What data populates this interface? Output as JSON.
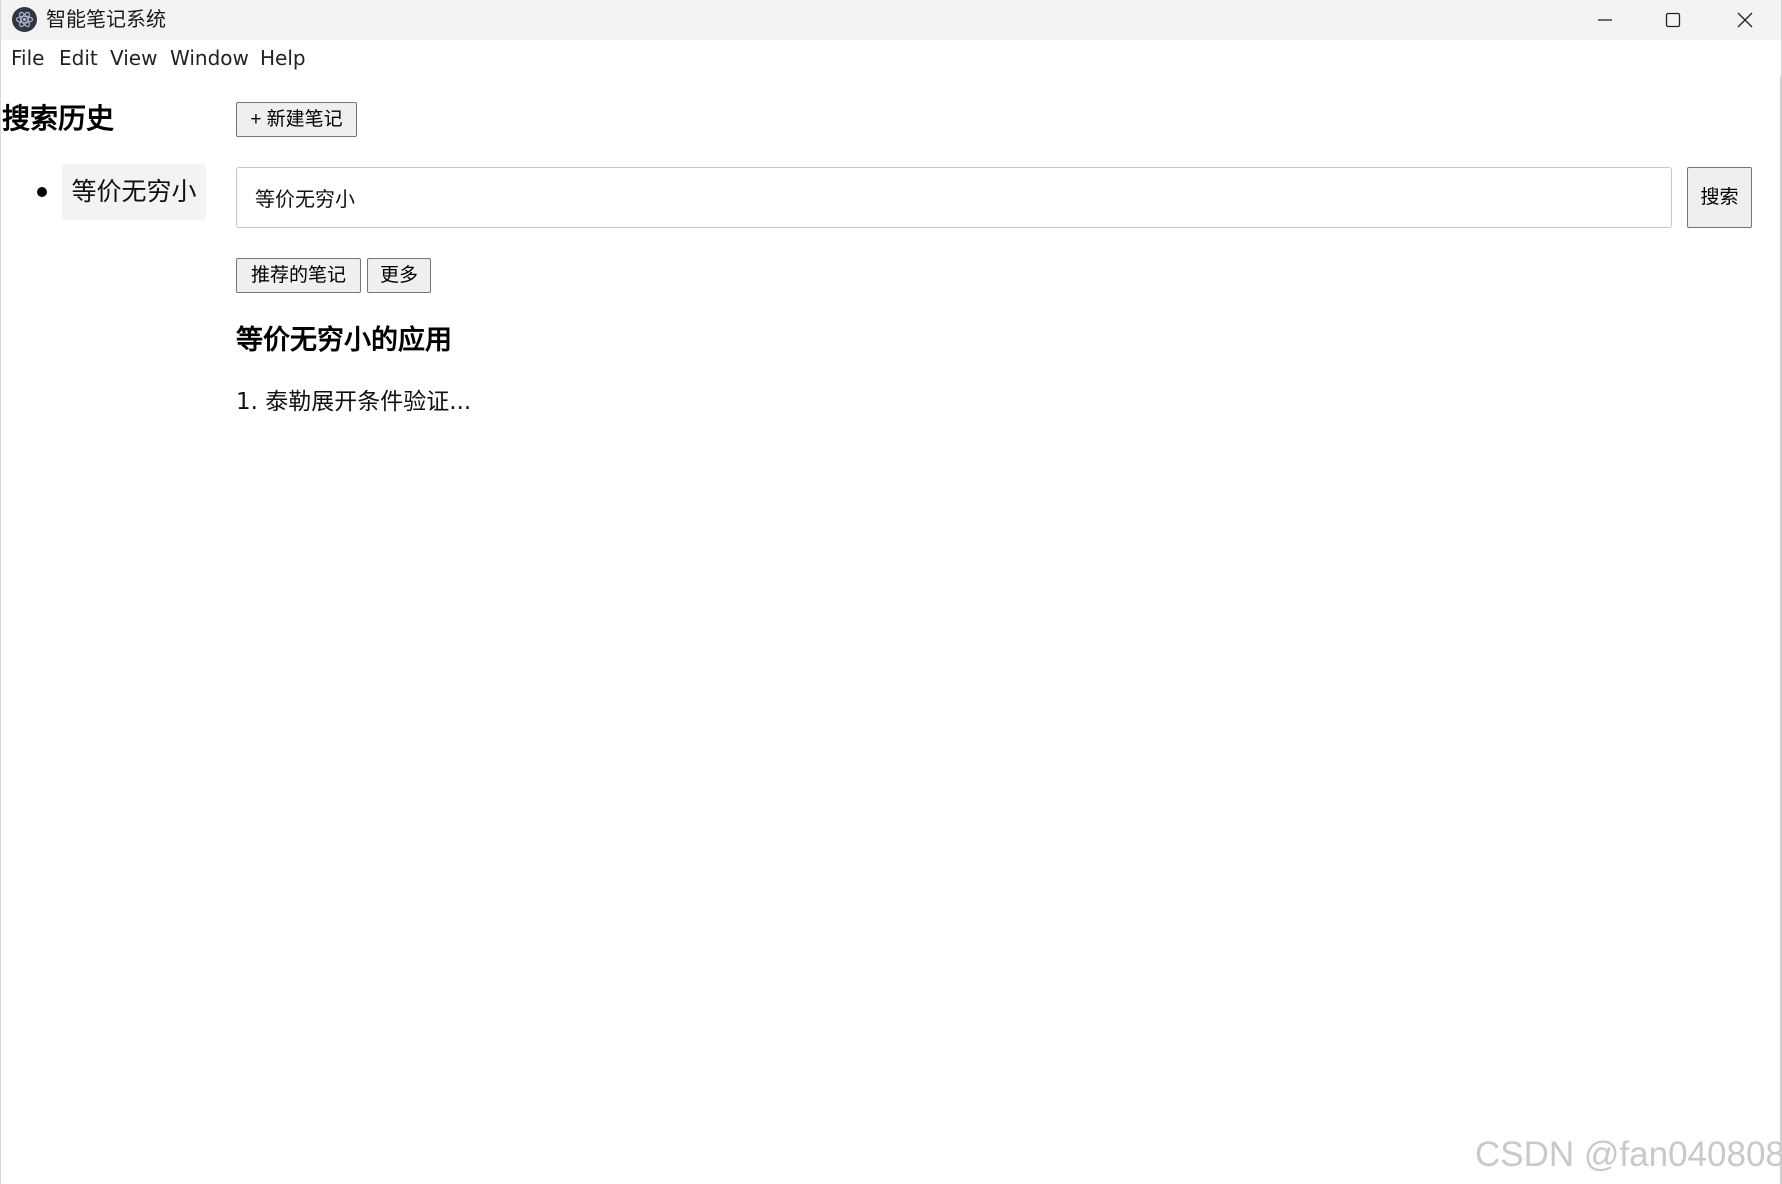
{
  "window": {
    "title": "智能笔记系统",
    "app_icon": "electron-atom-icon"
  },
  "title_controls": {
    "minimize_icon": "minimize-icon",
    "maximize_icon": "maximize-icon",
    "close_icon": "close-icon"
  },
  "menubar": {
    "items": [
      "File",
      "Edit",
      "View",
      "Window",
      "Help"
    ]
  },
  "sidebar": {
    "title": "搜索历史",
    "history": [
      "等价无穷小"
    ]
  },
  "toolbar": {
    "new_note_label": "+ 新建笔记"
  },
  "search": {
    "value": "等价无穷小",
    "button_label": "搜索"
  },
  "actions": {
    "recommend_label": "推荐的笔记",
    "more_label": "更多"
  },
  "result": {
    "title": "等价无穷小的应用",
    "lines": [
      "1. 泰勒展开条件验证..."
    ]
  },
  "watermark": "CSDN @fan040808",
  "colors": {
    "titlebar_bg": "#f3f3f3",
    "button_bg": "#efefef",
    "history_bg": "#f3f3f3"
  }
}
